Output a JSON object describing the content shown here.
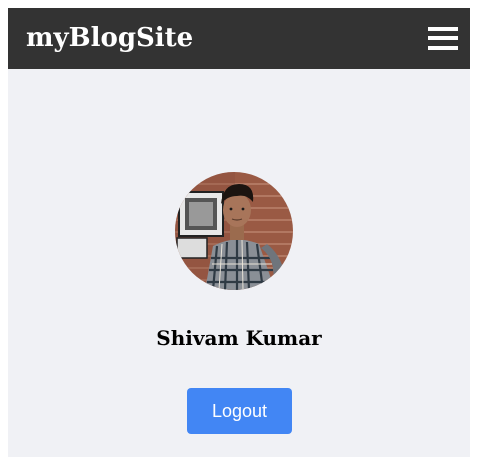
{
  "navbar": {
    "brand": "myBlogSite",
    "menu_icon": "hamburger-menu-icon",
    "background_color": "#333333"
  },
  "profile": {
    "avatar_alt": "Profile photo",
    "name": "Shivam Kumar"
  },
  "actions": {
    "logout_label": "Logout",
    "logout_color": "#4286f4"
  },
  "page": {
    "background_color": "#f0f1f5"
  }
}
